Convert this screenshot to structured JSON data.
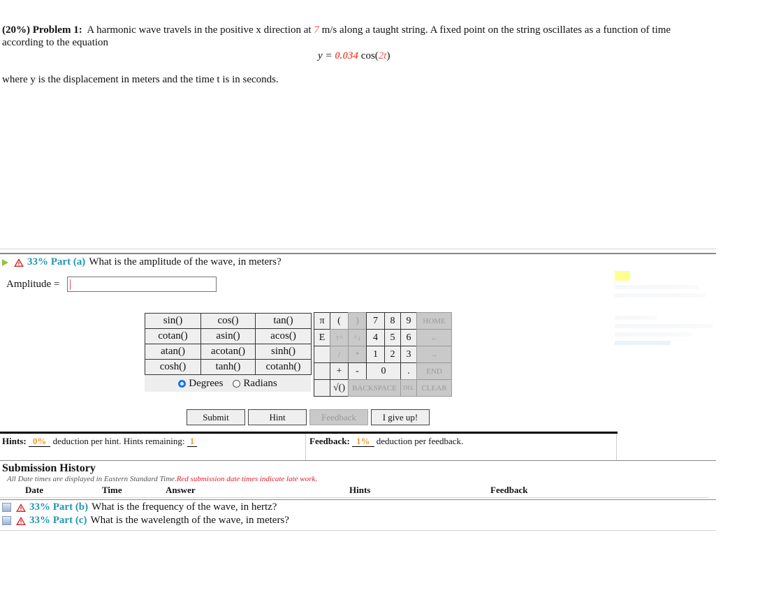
{
  "problem": {
    "weight": "(20%)",
    "label": "Problem 1:",
    "text_before_speed": "A harmonic wave travels in the positive x direction at",
    "speed": "7",
    "text_after_speed": "m/s along a taught string. A fixed point on the string oscillates as a function of time according to the equation",
    "equation_lhs": "y = ",
    "equation_amplitude": "0.034",
    "equation_func": " cos(",
    "equation_arg": "2t",
    "equation_close": ")",
    "where_text": "where y is the displacement in meters and the time t is in seconds."
  },
  "part_a": {
    "tag": "33% Part (a)",
    "question": "What is the amplitude of the wave, in meters?",
    "input_label": "Amplitude =",
    "input_value": ""
  },
  "calculator": {
    "functions": [
      "sin()",
      "cos()",
      "tan()",
      "cotan()",
      "asin()",
      "acos()",
      "atan()",
      "acotan()",
      "sinh()",
      "cosh()",
      "tanh()",
      "cotanh()"
    ],
    "angle_modes": [
      "Degrees",
      "Radians"
    ],
    "selected_mode": "Degrees",
    "keypad": {
      "pi": "π",
      "open_paren": "(",
      "close_paren": ")",
      "k7": "7",
      "k8": "8",
      "k9": "9",
      "home": "HOME",
      "e": "E",
      "up": "↑^",
      "down": "^↓",
      "k4": "4",
      "k5": "5",
      "k6": "6",
      "left": "←",
      "divide": "/",
      "multiply": "*",
      "k1": "1",
      "k2": "2",
      "k3": "3",
      "right": "→",
      "plus": "+",
      "minus": "-",
      "k0": "0",
      "dot": ".",
      "end": "END",
      "sqrt": "√()",
      "backspace": "BACKSPACE",
      "del": "DEL",
      "clear": "CLEAR"
    }
  },
  "actions": {
    "submit": "Submit",
    "hint": "Hint",
    "feedback": "Feedback",
    "give_up": "I give up!"
  },
  "hints": {
    "label": "Hints:",
    "deduction": "0%",
    "text": "deduction per hint. Hints remaining:",
    "remaining": "1"
  },
  "feedback": {
    "label": "Feedback:",
    "deduction": "1%",
    "text": "deduction per feedback."
  },
  "submission_history": {
    "title": "Submission History",
    "note": "All Date times are displayed in Eastern Standard Time.",
    "late_note": "Red submission date times indicate late work.",
    "columns": [
      "Date",
      "Time",
      "Answer",
      "Hints",
      "Feedback"
    ]
  },
  "other_parts": [
    {
      "tag": "33% Part (b)",
      "question": "What is the frequency of the wave, in hertz?"
    },
    {
      "tag": "33% Part (c)",
      "question": "What is the wavelength of the wave, in meters?"
    }
  ],
  "colors": {
    "accent_blue": "#2196b3",
    "variable_red": "#f45a4a",
    "percent_orange": "#f59a23",
    "late_red": "#e0202a"
  }
}
